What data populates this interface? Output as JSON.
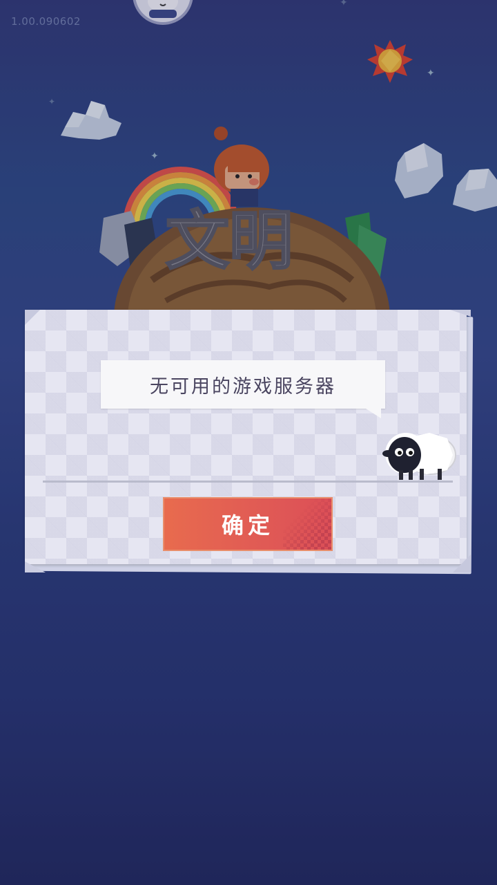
{
  "version": "1.00.090602",
  "game_title": "文明",
  "dialog": {
    "message": "无可用的游戏服务器",
    "confirm_label": "确定"
  },
  "colors": {
    "background": "#2e4080",
    "button": "#e05a55",
    "paper": "#e6e6f2"
  },
  "icons": {
    "avatar": "panda-avatar-icon",
    "sun": "sun-icon",
    "sheep": "sheep-mascot-icon"
  }
}
